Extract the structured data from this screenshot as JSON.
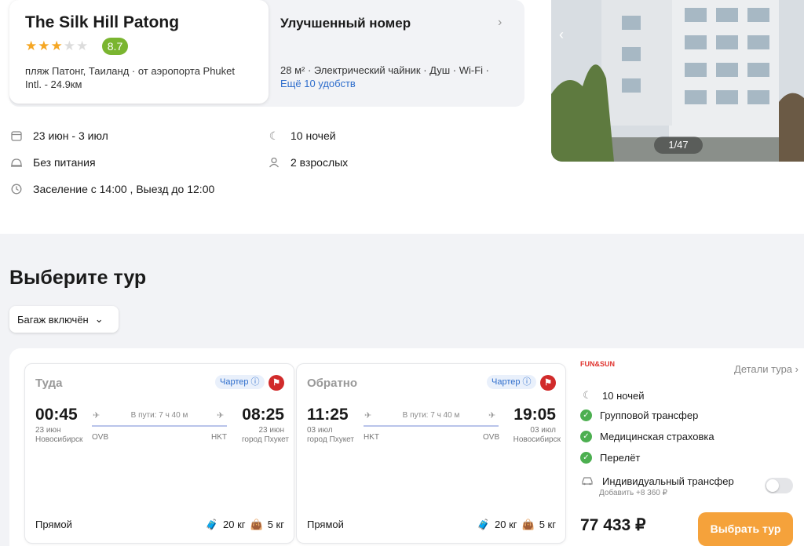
{
  "hotel": {
    "name": "The Silk Hill Patong",
    "stars": 3,
    "stars_max": 5,
    "rating": "8.7",
    "location": "пляж Патонг, Таиланд  · от аэропорта Phuket Intl. - 24.9км"
  },
  "room": {
    "title": "Улучшенный номер",
    "amenities": "28 м² · Электрический чайник · Душ · Wi-Fi ·",
    "more": "Ещё 10 удобств"
  },
  "photo": {
    "counter": "1/47"
  },
  "stay": {
    "dates": "23 июн - 3 июл",
    "nights": "10 ночей",
    "meal": "Без питания",
    "guests": "2 взрослых",
    "checkin": "Заселение с 14:00 , Выезд до 12:00"
  },
  "section": {
    "title": "Выберите тур",
    "filter": "Багаж включён"
  },
  "flights": [
    {
      "dir": "Туда",
      "charter": "Чартер ⓘ",
      "dep_time": "00:45",
      "arr_time": "08:25",
      "duration": "В пути: 7 ч 40 м",
      "dep_date": "23 июн",
      "dep_city": "Новосибирск",
      "dep_code": "OVB",
      "arr_date": "23 июн",
      "arr_city": "город Пхукет",
      "arr_code": "HKT",
      "type": "Прямой",
      "bag1": "20 кг",
      "bag2": "5 кг"
    },
    {
      "dir": "Обратно",
      "charter": "Чартер ⓘ",
      "dep_time": "11:25",
      "arr_time": "19:05",
      "duration": "В пути: 7 ч 40 м",
      "dep_date": "03 июл",
      "dep_city": "город Пхукет",
      "dep_code": "HKT",
      "arr_date": "03 июл",
      "arr_city": "Новосибирск",
      "arr_code": "OVB",
      "type": "Прямой",
      "bag1": "20 кг",
      "bag2": "5 кг"
    }
  ],
  "tour": {
    "operator": "FUN&SUN",
    "details": "Детали тура",
    "nights": "10 ночей",
    "transfer": "Групповой трансфер",
    "insurance": "Медицинская страховка",
    "flight": "Перелёт",
    "ind_transfer": "Индивидуальный трансфер",
    "ind_add": "Добавить +8 360 ₽",
    "ind_on": false,
    "price": "77 433 ₽",
    "button": "Выбрать тур"
  },
  "colors": {
    "accent": "#f5a23b",
    "rating": "#7ab530",
    "link": "#2f6ecc",
    "check": "#4caf50"
  }
}
